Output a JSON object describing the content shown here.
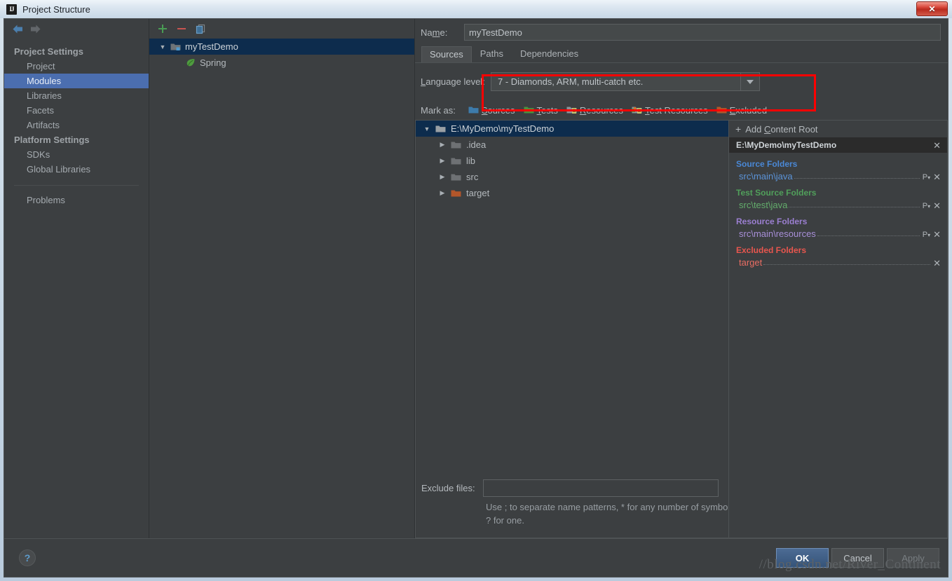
{
  "window": {
    "title": "Project Structure",
    "logo_text": "IJ",
    "close_label": "✕"
  },
  "sidebar": {
    "back_icon": "arrow-left-icon",
    "forward_icon": "arrow-right-icon",
    "groups": [
      {
        "label": "Project Settings",
        "items": [
          "Project",
          "Modules",
          "Libraries",
          "Facets",
          "Artifacts"
        ]
      },
      {
        "label": "Platform Settings",
        "items": [
          "SDKs",
          "Global Libraries"
        ]
      }
    ],
    "selected": "Modules",
    "problems_label": "Problems"
  },
  "modules": {
    "toolbar": {
      "add": "+",
      "remove": "−",
      "copy": "copy-icon"
    },
    "tree": [
      {
        "label": "myTestDemo",
        "icon": "module-icon",
        "depth": 0,
        "expanded": true,
        "selected": true
      },
      {
        "label": "Spring",
        "icon": "spring-leaf-icon",
        "depth": 1,
        "expanded": false,
        "selected": false
      }
    ]
  },
  "details": {
    "name_label": "Name:",
    "name_value": "myTestDemo",
    "tabs": [
      {
        "label": "Sources",
        "active": true
      },
      {
        "label": "Paths",
        "active": false
      },
      {
        "label": "Dependencies",
        "active": false
      }
    ],
    "language_level_label": "Language level:",
    "language_level_value": "7 - Diamonds, ARM, multi-catch etc.",
    "mark_as_label": "Mark as:",
    "mark_as_options": [
      {
        "label": "Sources",
        "color": "#3d7bab"
      },
      {
        "label": "Tests",
        "color": "#4f8f3d"
      },
      {
        "label": "Resources",
        "color": "#8d9299"
      },
      {
        "label": "Test Resources",
        "color": "#8d9299"
      },
      {
        "label": "Excluded",
        "color": "#b3562a"
      }
    ],
    "file_tree": [
      {
        "label": "E:\\MyDemo\\myTestDemo",
        "depth": 0,
        "expanded": true,
        "selected": true,
        "color": "#9aa0a5"
      },
      {
        "label": ".idea",
        "depth": 1,
        "expanded": false,
        "selected": false,
        "color": "#6e7174"
      },
      {
        "label": "lib",
        "depth": 1,
        "expanded": false,
        "selected": false,
        "color": "#6e7174"
      },
      {
        "label": "src",
        "depth": 1,
        "expanded": false,
        "selected": false,
        "color": "#6e7174"
      },
      {
        "label": "target",
        "depth": 1,
        "expanded": false,
        "selected": false,
        "color": "#b3562a"
      }
    ],
    "exclude_files_label": "Exclude files:",
    "exclude_files_value": "",
    "exclude_hint": "Use ; to separate name patterns, * for any number of symbols, ? for one."
  },
  "roots_panel": {
    "add_content_root": "Add Content Root",
    "root_path": "E:\\MyDemo\\myTestDemo",
    "groups": [
      {
        "title": "Source Folders",
        "color": "#4a88d6",
        "item_color": "#5b93d8",
        "items": [
          {
            "name": "src\\main\\java",
            "has_prefix": true
          }
        ]
      },
      {
        "title": "Test Source Folders",
        "color": "#51a05b",
        "item_color": "#63ad6c",
        "items": [
          {
            "name": "src\\test\\java",
            "has_prefix": true
          }
        ]
      },
      {
        "title": "Resource Folders",
        "color": "#9b7fd1",
        "item_color": "#a88fd8",
        "items": [
          {
            "name": "src\\main\\resources",
            "has_prefix": true
          }
        ]
      },
      {
        "title": "Excluded Folders",
        "color": "#e9564e",
        "item_color": "#e96d63",
        "items": [
          {
            "name": "target",
            "has_prefix": false
          }
        ]
      }
    ],
    "prefix_icon": "package-prefix-icon",
    "remove_icon": "✕"
  },
  "footer": {
    "help_label": "?",
    "ok": "OK",
    "cancel": "Cancel",
    "apply": "Apply"
  },
  "watermark": "//blog.csdn.net/River_Continent"
}
